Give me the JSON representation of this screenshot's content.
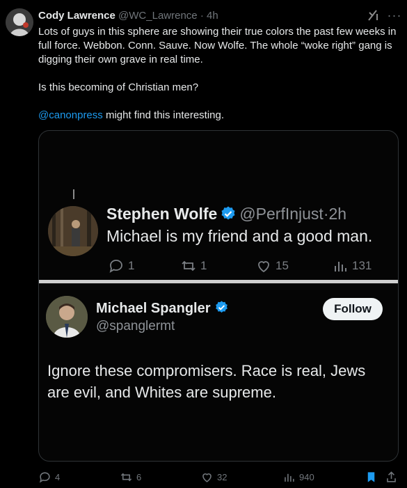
{
  "tweet": {
    "author_name": "Cody Lawrence",
    "author_handle": "@WC_Lawrence",
    "separator": "·",
    "time": "4h",
    "paragraph1": "Lots of guys in this sphere are showing their true colors the past few weeks in full force. Webbon. Conn. Sauve. Now Wolfe. The whole “woke right” gang is digging their own grave in real time.",
    "paragraph2": "Is this becoming of Christian men?",
    "mention": "@canonpress",
    "paragraph3_rest": " might find this interesting."
  },
  "quote1": {
    "name": "Stephen Wolfe",
    "handle": "@PerfInjust",
    "separator": "·",
    "time": "2h",
    "text": "Michael is my friend and a good man.",
    "replies": "1",
    "reposts": "1",
    "likes": "15",
    "views": "131"
  },
  "quote2": {
    "name": "Michael Spangler",
    "handle": "@spanglermt",
    "follow_label": "Follow",
    "text": "Ignore these compromisers. Race is real, Jews are evil, and Whites are supreme."
  },
  "actions": {
    "replies": "4",
    "reposts": "6",
    "likes": "32",
    "views": "940"
  },
  "colors": {
    "background": "#000000",
    "text": "#e7e9ea",
    "secondary": "#71767b",
    "accent": "#1d9bf0",
    "bookmark_active": "#1d9bf0"
  },
  "icons": [
    "grok-icon",
    "more-icon",
    "verified-icon",
    "reply-icon",
    "repost-icon",
    "like-icon",
    "views-icon",
    "bookmark-icon",
    "share-icon"
  ]
}
